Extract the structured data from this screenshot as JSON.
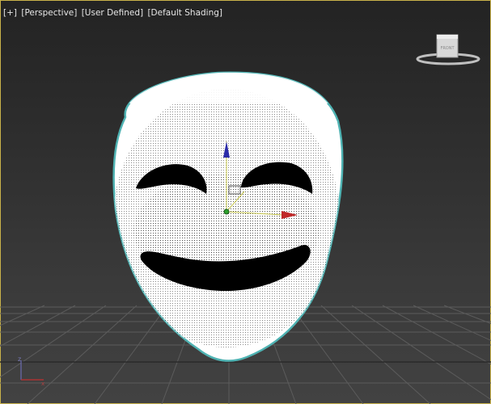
{
  "viewport": {
    "menu": "[+]",
    "view": "[Perspective]",
    "camera": "[User Defined]",
    "shading": "[Default Shading]"
  },
  "viewcube": {
    "face_label": "FRONT"
  },
  "axis": {
    "z_label": "z",
    "x_label": "x"
  },
  "colors": {
    "border_active": "#c9b24a",
    "grid": "#5a5a5a",
    "mesh_outline": "#4fb3b3",
    "gizmo_y": "#2c2ca8",
    "gizmo_x": "#c02828",
    "gizmo_z": "#2ea02e"
  }
}
